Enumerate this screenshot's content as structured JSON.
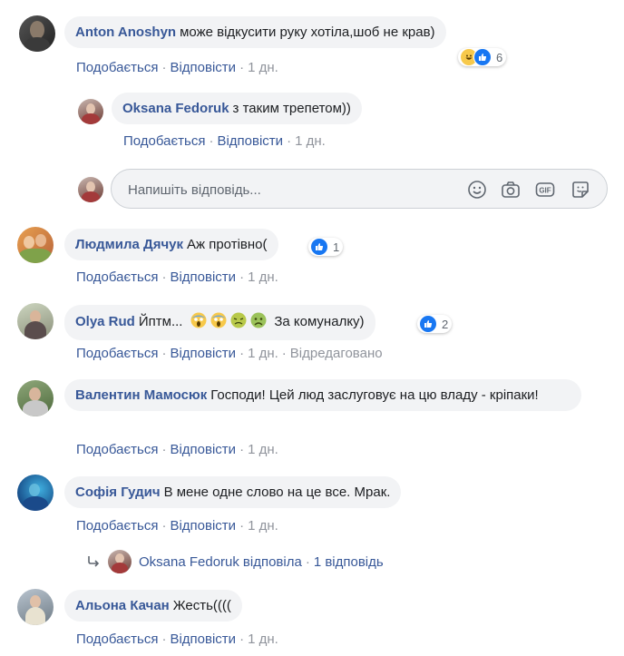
{
  "comments": [
    {
      "author": "Anton Anoshyn",
      "text": "може відкусити руку хотіла,шоб не крав)",
      "like": "Подобається",
      "reply": "Відповісти",
      "time": "1 дн.",
      "reaction_count": "6"
    },
    {
      "author": "Oksana Fedoruk",
      "text": "з таким трепетом))",
      "like": "Подобається",
      "reply": "Відповісти",
      "time": "1 дн."
    },
    {
      "author": "Людмила Дячук",
      "text": "Аж протівно(",
      "like": "Подобається",
      "reply": "Відповісти",
      "time": "1 дн.",
      "reaction_count": "1"
    },
    {
      "author": "Olya Rud",
      "text_before": "Йптм...",
      "text_after": "За комуналку)",
      "like": "Подобається",
      "reply": "Відповісти",
      "time": "1 дн.",
      "edited": "Відредаговано",
      "reaction_count": "2"
    },
    {
      "author": "Валентин Мамосюк",
      "text": "Господи! Цей люд заслуговує на цю владу - кріпаки!",
      "like": "Подобається",
      "reply": "Відповісти",
      "time": "1 дн."
    },
    {
      "author": "Софія Гудич",
      "text": "В мене одне слово на це все. Мрак.",
      "like": "Подобається",
      "reply": "Відповісти",
      "time": "1 дн."
    },
    {
      "author": "Альона Качан",
      "text": "Жесть((((",
      "like": "Подобається",
      "reply": "Відповісти",
      "time": "1 дн."
    }
  ],
  "reply_input": {
    "placeholder": "Напишіть відповідь..."
  },
  "replies_summary": {
    "author": "Oksana Fedoruk",
    "verb": "відповіла",
    "count": "1 відповідь"
  },
  "colors": {
    "link": "#385898",
    "bubble": "#f2f3f5",
    "meta": "#90949c",
    "like_blue": "#1877f2"
  }
}
